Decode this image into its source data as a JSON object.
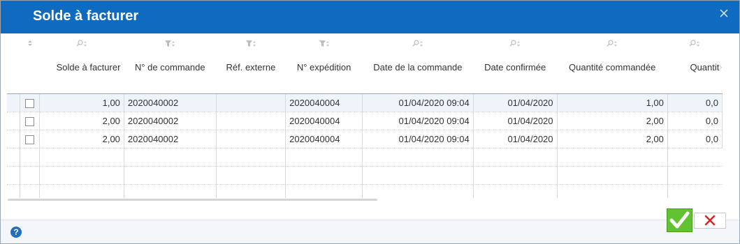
{
  "dialog": {
    "title": "Solde à facturer",
    "close_icon": "close-icon"
  },
  "grid": {
    "columns": [
      {
        "label": "",
        "icon": "sort-icon"
      },
      {
        "label": "Solde à facturer",
        "icon": "search-icon"
      },
      {
        "label": "N° de commande",
        "icon": "filter-icon"
      },
      {
        "label": "Réf. externe",
        "icon": "filter-icon"
      },
      {
        "label": "N° expédition",
        "icon": "filter-icon"
      },
      {
        "label": "Date de la commande",
        "icon": "search-icon"
      },
      {
        "label": "Date confirmée",
        "icon": "search-icon"
      },
      {
        "label": "Quantité commandée",
        "icon": "search-icon"
      },
      {
        "label": "Quantit",
        "icon": "search-icon"
      }
    ],
    "rows": [
      {
        "solde": "1,00",
        "commande": "2020040002",
        "ref": "",
        "expedition": "2020040004",
        "date_commande": "01/04/2020 09:04",
        "date_confirmee": "01/04/2020",
        "quantite": "1,00",
        "quantite2": "0,0"
      },
      {
        "solde": "2,00",
        "commande": "2020040002",
        "ref": "",
        "expedition": "2020040004",
        "date_commande": "01/04/2020 09:04",
        "date_confirmee": "01/04/2020",
        "quantite": "2,00",
        "quantite2": "0,0"
      },
      {
        "solde": "2,00",
        "commande": "2020040002",
        "ref": "",
        "expedition": "2020040004",
        "date_commande": "01/04/2020 09:04",
        "date_confirmee": "01/04/2020",
        "quantite": "2,00",
        "quantite2": "0,0"
      }
    ],
    "selected_row": 0
  },
  "footer": {
    "help_label": "?",
    "ok_icon": "checkmark-icon",
    "cancel_icon": "cancel-x-icon"
  },
  "colors": {
    "titlebar": "#0e6bc0",
    "ok_green": "#62c231",
    "cancel_red": "#e02020"
  }
}
